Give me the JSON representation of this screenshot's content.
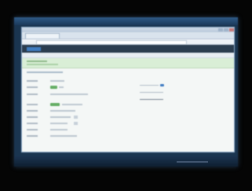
{
  "screen": {
    "background_color": "#000000",
    "window_accent": "#3e7bc2",
    "success_color": "#64ad64"
  }
}
